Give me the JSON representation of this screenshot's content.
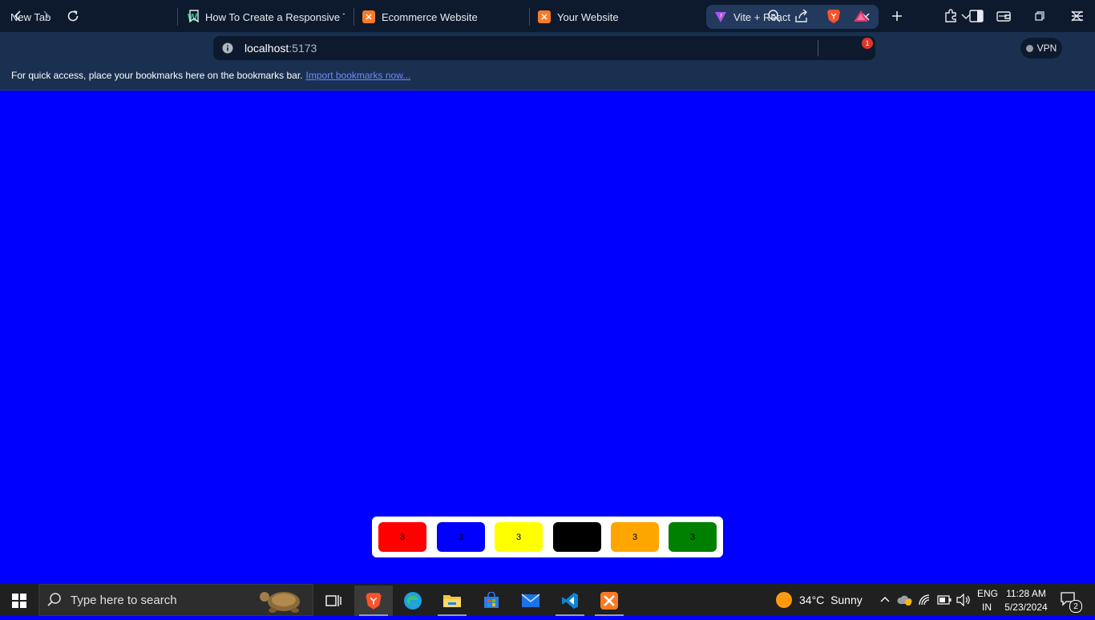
{
  "browser": {
    "tabs": [
      {
        "title": "New Tab",
        "icon": "new-tab-icon",
        "active": false
      },
      {
        "title": "How To Create a Responsive Top",
        "icon": "w-site-icon",
        "active": false
      },
      {
        "title": "Ecommerce Website",
        "icon": "xampp-icon",
        "active": false
      },
      {
        "title": "Your Website",
        "icon": "xampp-icon",
        "active": false
      },
      {
        "title": "Vite + React",
        "icon": "vite-icon",
        "active": true
      }
    ],
    "url_host": "localhost",
    "url_port": ":5173",
    "vpn_label": "VPN",
    "alert_count": "1",
    "bookmarks_message": "For quick access, place your bookmarks here on the bookmarks bar.",
    "import_link": "Import bookmarks now..."
  },
  "page": {
    "background": "#0000ff",
    "buttons": [
      {
        "label": "3",
        "color": "#ff0000"
      },
      {
        "label": "3",
        "color": "#0000ff"
      },
      {
        "label": "3",
        "color": "#ffff00"
      },
      {
        "label": "3",
        "color": "#000000"
      },
      {
        "label": "3",
        "color": "#ffa500"
      },
      {
        "label": "3",
        "color": "#008000"
      }
    ]
  },
  "taskbar": {
    "search_placeholder": "Type here to search",
    "weather_temp": "34°C",
    "weather_text": "Sunny",
    "lang_top": "ENG",
    "lang_bottom": "IN",
    "time": "11:28 AM",
    "date": "5/23/2024",
    "notification_count": "2"
  }
}
